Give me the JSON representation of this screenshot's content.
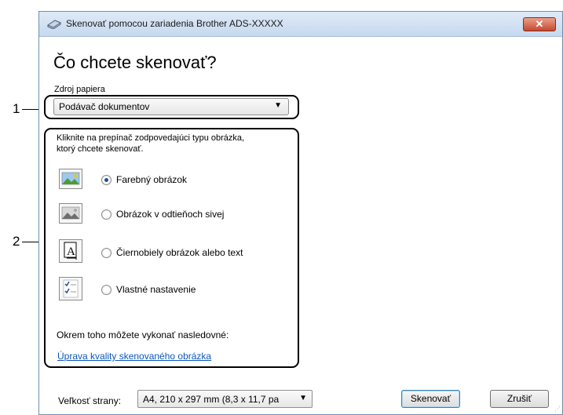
{
  "callouts": {
    "one": "1",
    "two": "2"
  },
  "window": {
    "title": "Skenovať pomocou zariadenia Brother ADS-XXXXX",
    "close_label": "✕"
  },
  "heading": "Čo chcete skenovať?",
  "source": {
    "label": "Zdroj papiera",
    "value": "Podávač dokumentov"
  },
  "instructions": {
    "line1": "Kliknite na prepínač zodpovedajúci typu obrázka,",
    "line2": "ktorý chcete skenovať."
  },
  "options": [
    {
      "label": "Farebný obrázok",
      "selected": true,
      "icon": "color-picture-icon"
    },
    {
      "label": "Obrázok v odtieňoch sivej",
      "selected": false,
      "icon": "grayscale-picture-icon"
    },
    {
      "label": "Čiernobiely obrázok alebo text",
      "selected": false,
      "icon": "black-white-text-icon"
    },
    {
      "label": "Vlastné nastavenie",
      "selected": false,
      "icon": "custom-settings-icon"
    }
  ],
  "extra": {
    "label": "Okrem toho môžete vykonať nasledovné:",
    "link": "Úprava kvality skenovaného obrázka"
  },
  "footer": {
    "page_size_label": "Veľkosť strany:",
    "page_size_value": "A4, 210 x 297 mm (8,3 x 11,7 pa",
    "scan_button": "Skenovať",
    "cancel_button": "Zrušiť"
  }
}
